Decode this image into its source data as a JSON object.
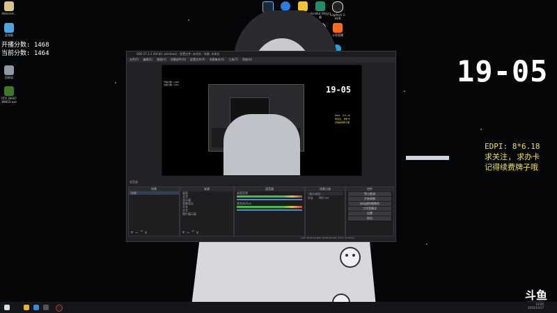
{
  "desktop": {
    "left_icons": [
      "Administ...",
      "此电脑",
      "回收站",
      "RTX 30607 WIN10.exe"
    ],
    "top_icons_row1": [
      "Steam",
      "鹅鹅发行",
      "YY语音",
      "VeraKut VA出口器",
      "Logitech G HUB"
    ],
    "top_icons_row2": [
      "QQ",
      "Office",
      "微信",
      "OBS Studio",
      "斗鱼直播"
    ],
    "score_lines": [
      "开播分数: 1468",
      "当前分数: 1464"
    ],
    "clock": "19-05",
    "edpi_lines": [
      "EDPI: 8*6.18",
      "求关注, 求办卡",
      "记得续费牌子哦"
    ],
    "watermark": {
      "brand": "斗鱼",
      "sub": "DOUYU.COM"
    }
  },
  "obs": {
    "title": "OBS 27.1.3 (64-bit, windows) - 配置文件: 未命名 - 场景: 未命名",
    "menu": [
      "文件(F)",
      "编辑(E)",
      "视图(V)",
      "停靠部件(D)",
      "配置文件(P)",
      "场景集合(S)",
      "工具(T)",
      "帮助(H)"
    ],
    "preview_inner_clock": "19-05",
    "audio_mixer_label": "混音器",
    "scenes_header": "场景",
    "scenes": [
      "场景"
    ],
    "sources_header": "来源",
    "sources": [
      "画面",
      "文字",
      "显示器",
      "背景音乐",
      "开关",
      "文字",
      "图片展示窗"
    ],
    "mixer_header": "混音器",
    "mixer_tracks": [
      {
        "name": "桌面音频",
        "level": "0.0 dB"
      },
      {
        "name": "麦克风/Aux",
        "level": "0.0 dB"
      }
    ],
    "transitions_header": "场景过渡",
    "transition_value": "淡入淡出",
    "duration_label": "时长",
    "duration_value": "300 ms",
    "controls_header": "控件",
    "controls": [
      "停止推流",
      "开始录制",
      "启动虚拟摄像机",
      "工作室模式",
      "设置",
      "退出"
    ],
    "status": "LIVE: 00:00:00   REC: 00:00:00   CPU: 3.5%, 30.00 fps"
  },
  "taskbar": {
    "time": "19:05",
    "date": "2022/10/17"
  }
}
